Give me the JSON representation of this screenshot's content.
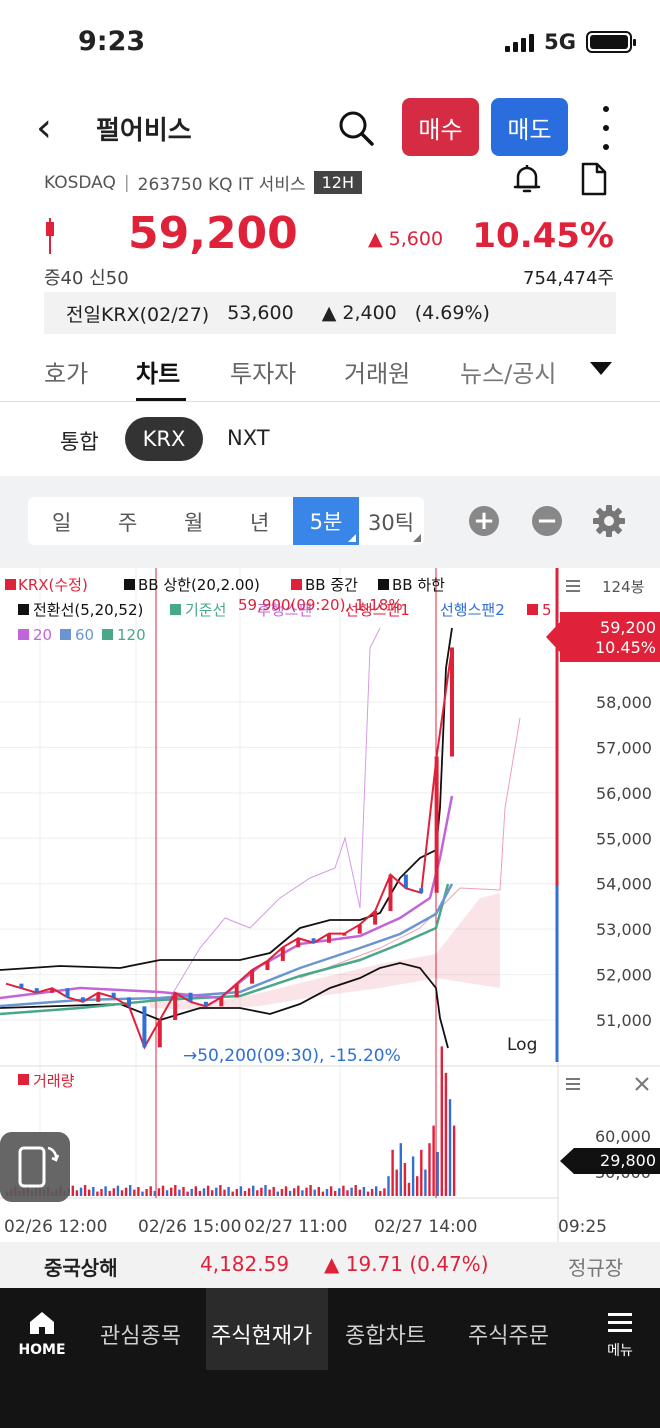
{
  "status": {
    "time": "9:23",
    "network": "5G"
  },
  "header": {
    "stock_name": "펄어비스",
    "buy_label": "매수",
    "sell_label": "매도"
  },
  "sub_info": {
    "market": "KOSDAQ",
    "code_sector": "263750 KQ IT 서비스",
    "badge": "12H"
  },
  "quote": {
    "price": "59,200",
    "change": "▲ 5,600",
    "change_pct": "10.45%",
    "margin": "증40  신50",
    "volume": "754,474주",
    "krx_label": "전일KRX(02/27)",
    "krx_price": "53,600",
    "krx_change": "▲ 2,400",
    "krx_pct": "(4.69%)"
  },
  "tabs": [
    "호가",
    "차트",
    "투자자",
    "거래원",
    "뉴스/공시"
  ],
  "market_tabs": {
    "left": "통합",
    "active": "KRX",
    "right": "NXT"
  },
  "periods": [
    "일",
    "주",
    "월",
    "년",
    "5분",
    "30틱"
  ],
  "chart": {
    "legend_row1": [
      "KRX(수정)",
      "BB 상한(20,2.00)",
      "BB 중간",
      "BB 하한"
    ],
    "legend_row2": [
      "전환선(5,20,52)",
      "기준선",
      "후행스팬",
      "선행스팬1",
      "선행스팬2",
      "5"
    ],
    "legend_row3": [
      "20",
      "60",
      "120"
    ],
    "bar_count": "124봉",
    "high_note": "59,900(09:20), 1.18%",
    "low_note": "→50,200(09:30), -15.20%",
    "price_tag_value": "59,200",
    "price_tag_pct": "10.45%",
    "log_label": "Log",
    "volume_label": "거래량",
    "volume_tag": "29,800",
    "volume_axis": [
      "60,000",
      "30,000"
    ],
    "x_labels": [
      "02/26 12:00",
      "02/26 15:00",
      "02/27 11:00",
      "02/27 14:00",
      "09:25"
    ]
  },
  "chart_data": {
    "type": "line",
    "title": "",
    "y_axis": [
      58000,
      57000,
      56000,
      55000,
      54000,
      53000,
      52000,
      51000
    ],
    "ylim": [
      50200,
      59900
    ],
    "series": [
      {
        "name": "KRX(수정)",
        "values": [
          51800,
          51700,
          51600,
          51700,
          51500,
          51400,
          51600,
          51500,
          51300,
          50400,
          51000,
          51600,
          51400,
          51300,
          51500,
          51800,
          52100,
          52300,
          52600,
          52800,
          52700,
          52900,
          52900,
          53100,
          53400,
          54200,
          53900,
          53800,
          56800,
          59200
        ]
      }
    ],
    "color_up": "#e0213a",
    "color_down": "#2f6fd6"
  },
  "index_bar": {
    "name": "중국상해",
    "value": "4,182.59",
    "change": "▲ 19.71 (0.47%)",
    "session": "정규장"
  },
  "nav": {
    "home": "HOME",
    "items": [
      "관심종목",
      "주식현재가",
      "종합차트",
      "주식주문"
    ],
    "menu": "메뉴"
  }
}
